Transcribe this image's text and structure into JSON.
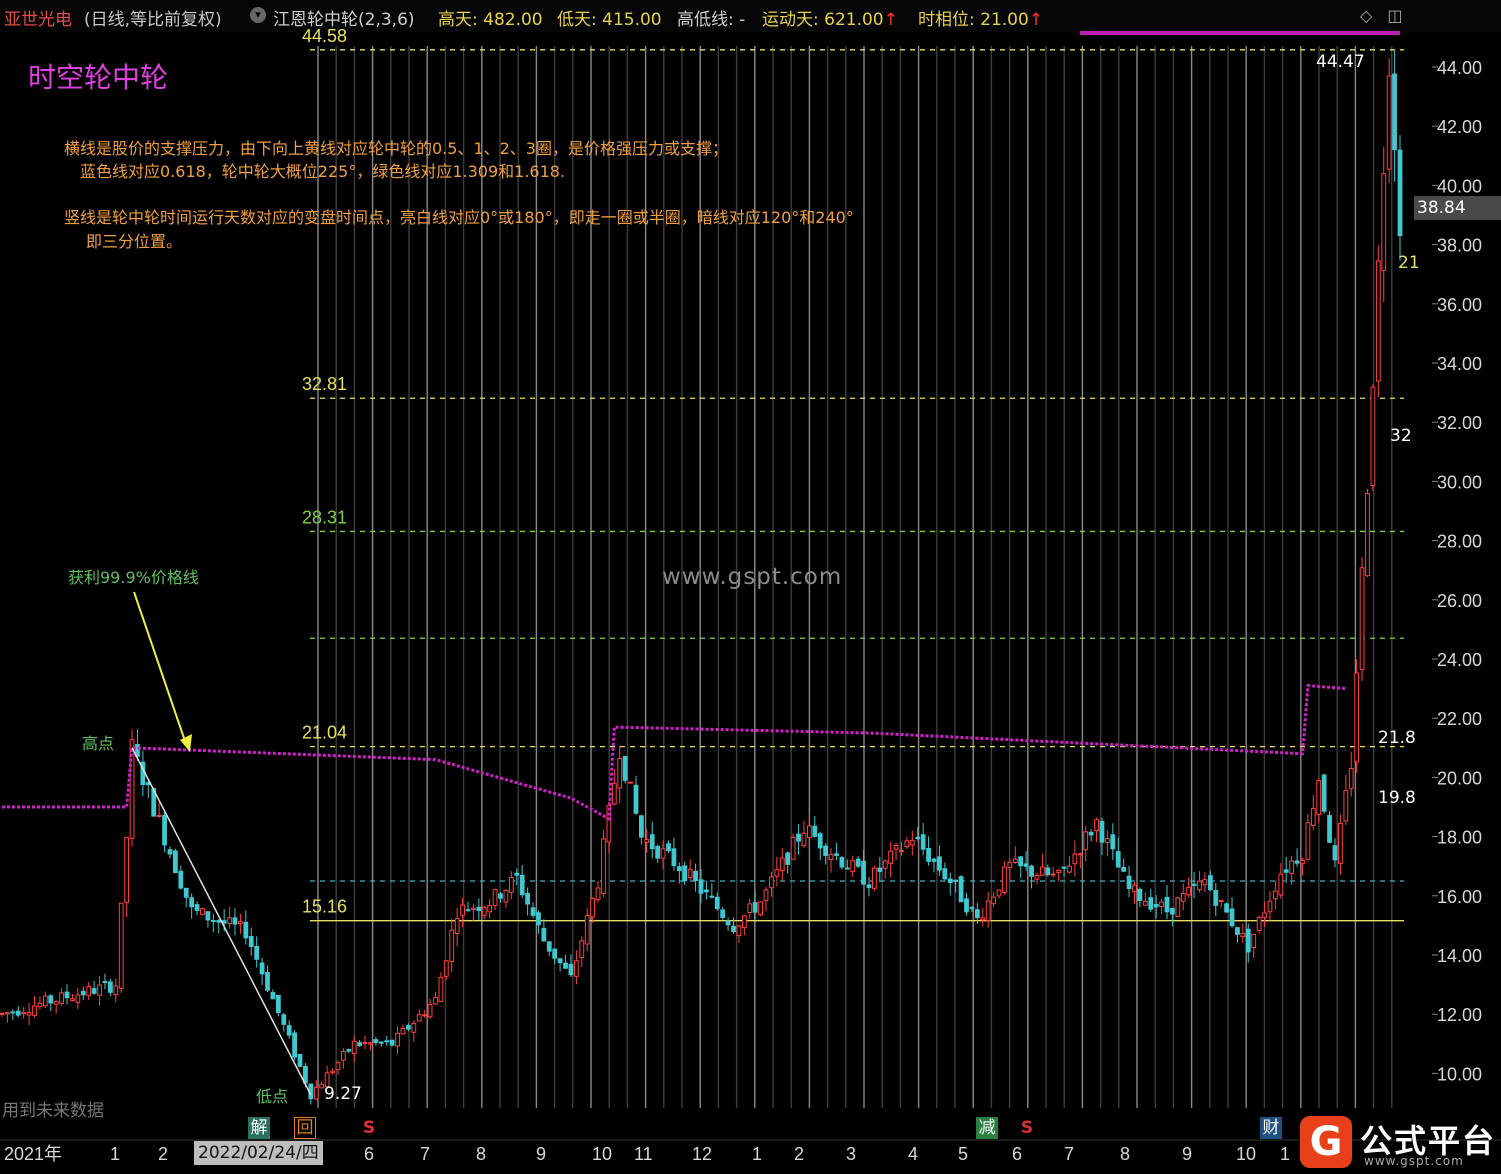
{
  "header": {
    "stock_name": "亚世光电",
    "period": "(日线,等比前复权)",
    "indicator_icon": "circle-chevron-icon",
    "indicator_name": "江恩轮中轮(2,3,6)",
    "high_label": "高天: 482.00",
    "low_label": "低天: 415.00",
    "hl_label": "高低线: -",
    "move_label": "运动天: 621.00",
    "phase_label": "时相位: 21.00",
    "arrow": "↑"
  },
  "annotations": {
    "title": "时空轮中轮",
    "note1": "横线是股价的支撑压力，由下向上黄线对应轮中轮的0.5、1、2、3圈，是价格强压力或支撑；",
    "note2": "蓝色线对应0.618，轮中轮大概位225°，绿色线对应1.309和1.618.",
    "note3": "竖线是轮中轮时间运行天数对应的变盘时间点，亮白线对应0°或180°，即走一圈或半圈，暗线对应120°和240°",
    "note4": "即三分位置。",
    "profit_line_note": "获利99.9%价格线",
    "high_point": "高点",
    "low_point": "低点",
    "low_value": "9.27",
    "watermark": "www.gspt.com",
    "future_data": "用到未来数据",
    "last_price": "38.84",
    "level_32": "32",
    "level_21_8": "21.8",
    "level_19_8": "19.8",
    "level_21_cut": "21",
    "high_value": "44.47"
  },
  "markers": {
    "jie": "解",
    "hui": "回",
    "s1": "S",
    "jian": "减",
    "s2": "S",
    "cai": "财"
  },
  "logo": {
    "glyph": "G",
    "text": "公式平台",
    "url": "www.gspt.com"
  },
  "colors": {
    "up": "#ff4040",
    "down": "#40c8d0",
    "profit_line": "#d020c8",
    "yellow_level": "#e8e060",
    "green_level": "#80d040",
    "blue_level": "#40b0c8",
    "background": "#000000"
  },
  "chart_data": {
    "type": "candlestick",
    "title": "时空轮中轮",
    "y_axis": {
      "ticks": [
        "44.00",
        "42.00",
        "40.00",
        "38.00",
        "36.00",
        "34.00",
        "32.00",
        "30.00",
        "28.00",
        "26.00",
        "24.00",
        "22.00",
        "20.00",
        "18.00",
        "16.00",
        "14.00",
        "12.00",
        "10.00"
      ],
      "ylim": [
        9.0,
        45.5
      ],
      "scale": "linear"
    },
    "x_axis": {
      "ticks": [
        "2021年",
        "1",
        "2",
        "2022/02/24/四",
        "6",
        "7",
        "8",
        "9",
        "10",
        "11",
        "12",
        "1",
        "2",
        "3",
        "4",
        "5",
        "6",
        "7",
        "8",
        "9",
        "10",
        "1"
      ]
    },
    "levels": [
      {
        "value": 44.58,
        "label": "44.58",
        "kind": "yellow"
      },
      {
        "value": 32.81,
        "label": "32.81",
        "kind": "yellow"
      },
      {
        "value": 28.31,
        "label": "28.31",
        "kind": "green"
      },
      {
        "value": 24.7,
        "label": "",
        "kind": "green"
      },
      {
        "value": 21.04,
        "label": "21.04",
        "kind": "yellow"
      },
      {
        "value": 16.5,
        "label": "",
        "kind": "blue"
      },
      {
        "value": 15.16,
        "label": "15.16",
        "kind": "yellow-solid"
      }
    ],
    "profit_line": [
      {
        "bar": 0,
        "value": 19.0
      },
      {
        "bar": 23,
        "value": 19.0
      },
      {
        "bar": 24,
        "value": 21.0
      },
      {
        "bar": 80,
        "value": 20.6
      },
      {
        "bar": 105,
        "value": 19.3
      },
      {
        "bar": 112,
        "value": 18.6
      },
      {
        "bar": 113,
        "value": 21.7
      },
      {
        "bar": 160,
        "value": 21.5
      },
      {
        "bar": 240,
        "value": 20.8
      },
      {
        "bar": 241,
        "value": 23.1
      },
      {
        "bar": 248,
        "value": 23.0
      }
    ],
    "close_trend": [
      {
        "bar": 0,
        "value": 12.0
      },
      {
        "bar": 12,
        "value": 12.6
      },
      {
        "bar": 21,
        "value": 13.0
      },
      {
        "bar": 23,
        "value": 18.0
      },
      {
        "bar": 24,
        "value": 21.0
      },
      {
        "bar": 35,
        "value": 15.5
      },
      {
        "bar": 45,
        "value": 14.8
      },
      {
        "bar": 57,
        "value": 9.3
      },
      {
        "bar": 65,
        "value": 11.0
      },
      {
        "bar": 72,
        "value": 11.0
      },
      {
        "bar": 80,
        "value": 12.5
      },
      {
        "bar": 84,
        "value": 15.5
      },
      {
        "bar": 90,
        "value": 15.8
      },
      {
        "bar": 95,
        "value": 16.6
      },
      {
        "bar": 100,
        "value": 14.5
      },
      {
        "bar": 105,
        "value": 13.2
      },
      {
        "bar": 110,
        "value": 16.5
      },
      {
        "bar": 114,
        "value": 21.0
      },
      {
        "bar": 118,
        "value": 18.0
      },
      {
        "bar": 125,
        "value": 17.0
      },
      {
        "bar": 135,
        "value": 15.0
      },
      {
        "bar": 140,
        "value": 15.8
      },
      {
        "bar": 148,
        "value": 18.3
      },
      {
        "bar": 155,
        "value": 17.2
      },
      {
        "bar": 160,
        "value": 16.5
      },
      {
        "bar": 168,
        "value": 18.0
      },
      {
        "bar": 175,
        "value": 16.5
      },
      {
        "bar": 180,
        "value": 15.2
      },
      {
        "bar": 186,
        "value": 17.0
      },
      {
        "bar": 195,
        "value": 16.6
      },
      {
        "bar": 202,
        "value": 18.5
      },
      {
        "bar": 208,
        "value": 16.2
      },
      {
        "bar": 215,
        "value": 15.5
      },
      {
        "bar": 222,
        "value": 16.5
      },
      {
        "bar": 230,
        "value": 14.3
      },
      {
        "bar": 236,
        "value": 16.8
      },
      {
        "bar": 240,
        "value": 17.5
      },
      {
        "bar": 243,
        "value": 20.0
      },
      {
        "bar": 246,
        "value": 17.0
      },
      {
        "bar": 249,
        "value": 20.5
      },
      {
        "bar": 252,
        "value": 30.0
      },
      {
        "bar": 256,
        "value": 44.47
      },
      {
        "bar": 258,
        "value": 38.84
      }
    ],
    "total_bars": 259,
    "last_price": 38.84,
    "high": 44.47,
    "low": 9.27
  }
}
